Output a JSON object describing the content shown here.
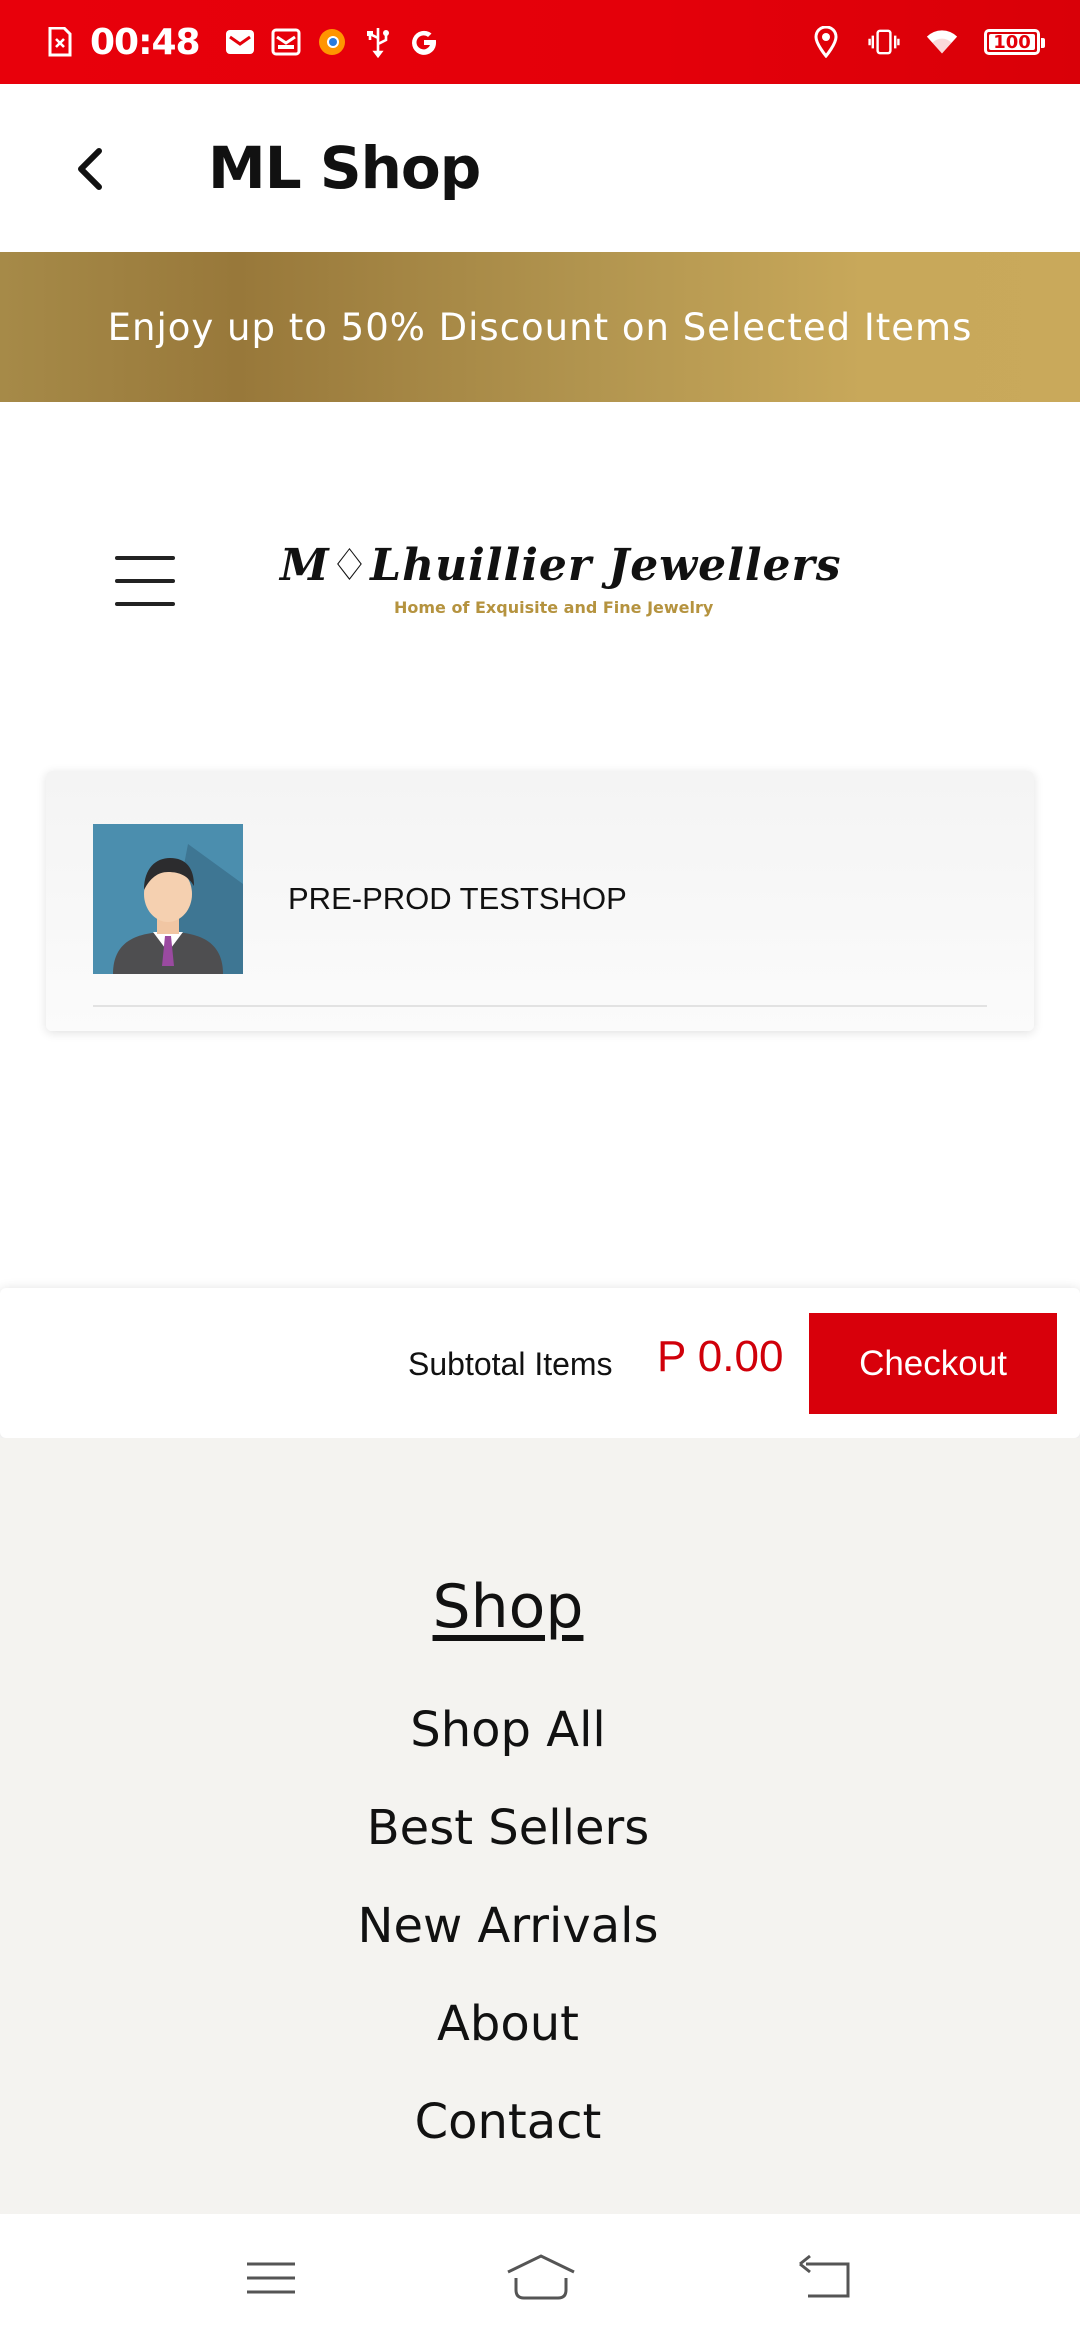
{
  "status_bar": {
    "time": "00:48",
    "battery": "100",
    "battery_level_percent": 100,
    "left_icons": [
      "sim-off-icon",
      "mail-icon",
      "email-icon",
      "firefox-icon",
      "usb-icon",
      "google-icon"
    ],
    "right_icons": [
      "location-icon",
      "vibrate-icon",
      "wifi-icon",
      "battery-icon"
    ]
  },
  "app_bar": {
    "title": "ML Shop",
    "back_icon": "chevron-left-icon"
  },
  "promo": {
    "text": "Enjoy up to 50% Discount on Selected Items"
  },
  "brand": {
    "name": "M♢Lhuillier Jewellers",
    "tagline": "Home of Exquisite and Fine Jewelry",
    "menu_icon": "hamburger-menu-icon"
  },
  "shop_card": {
    "name": "PRE-PROD TESTSHOP",
    "avatar_icon": "businessman-avatar-icon"
  },
  "cart": {
    "subtotal_label": "Subtotal Items",
    "subtotal_value": "P 0.00",
    "checkout_label": "Checkout"
  },
  "footer": {
    "heading": "Shop",
    "links": [
      "Shop All",
      "Best Sellers",
      "New Arrivals",
      "About",
      "Contact"
    ]
  },
  "nav_bar": {
    "icons": [
      "recent-apps-icon",
      "home-icon",
      "back-icon"
    ]
  },
  "colors": {
    "status_bar": "#e4000a",
    "accent_red": "#d8000b",
    "gold": "#b5933f",
    "footer_bg": "#f4f3f0"
  }
}
